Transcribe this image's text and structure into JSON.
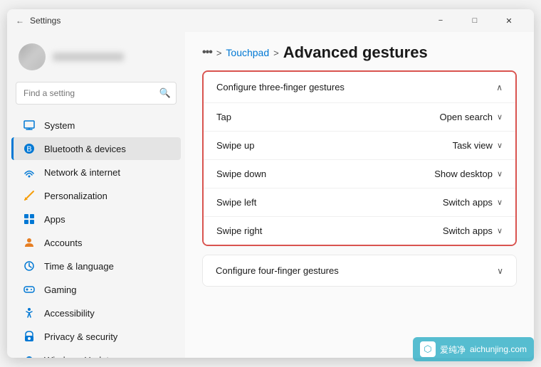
{
  "window": {
    "title": "Settings",
    "titlebar": {
      "back_icon": "←",
      "title": "Settings",
      "minimize": "−",
      "maximize": "□",
      "close": "✕"
    }
  },
  "sidebar": {
    "search_placeholder": "Find a setting",
    "items": [
      {
        "id": "system",
        "label": "System",
        "icon": "🖥",
        "active": false
      },
      {
        "id": "bluetooth",
        "label": "Bluetooth & devices",
        "icon": "🔵",
        "active": true
      },
      {
        "id": "network",
        "label": "Network & internet",
        "icon": "🌐",
        "active": false
      },
      {
        "id": "personalization",
        "label": "Personalization",
        "icon": "✏",
        "active": false
      },
      {
        "id": "apps",
        "label": "Apps",
        "icon": "📱",
        "active": false
      },
      {
        "id": "accounts",
        "label": "Accounts",
        "icon": "👤",
        "active": false
      },
      {
        "id": "time",
        "label": "Time & language",
        "icon": "🕐",
        "active": false
      },
      {
        "id": "gaming",
        "label": "Gaming",
        "icon": "🎮",
        "active": false
      },
      {
        "id": "accessibility",
        "label": "Accessibility",
        "icon": "♿",
        "active": false
      },
      {
        "id": "privacy",
        "label": "Privacy & security",
        "icon": "🔒",
        "active": false
      },
      {
        "id": "update",
        "label": "Windows Update",
        "icon": "🔄",
        "active": false
      }
    ]
  },
  "content": {
    "breadcrumb": {
      "dots": "•••",
      "separator1": ">",
      "link1": "Touchpad",
      "separator2": ">",
      "current": "Advanced gestures"
    },
    "sections": [
      {
        "id": "three-finger",
        "title": "Configure three-finger gestures",
        "expanded": true,
        "highlighted": true,
        "chevron": "∧",
        "gestures": [
          {
            "label": "Tap",
            "value": "Open search"
          },
          {
            "label": "Swipe up",
            "value": "Task view"
          },
          {
            "label": "Swipe down",
            "value": "Show desktop"
          },
          {
            "label": "Swipe left",
            "value": "Switch apps"
          },
          {
            "label": "Swipe right",
            "value": "Switch apps"
          }
        ]
      },
      {
        "id": "four-finger",
        "title": "Configure four-finger gestures",
        "expanded": false,
        "highlighted": false,
        "chevron": "∨",
        "gestures": []
      }
    ]
  },
  "watermark": {
    "text": "爱纯净",
    "site": "aichunjing.com"
  }
}
